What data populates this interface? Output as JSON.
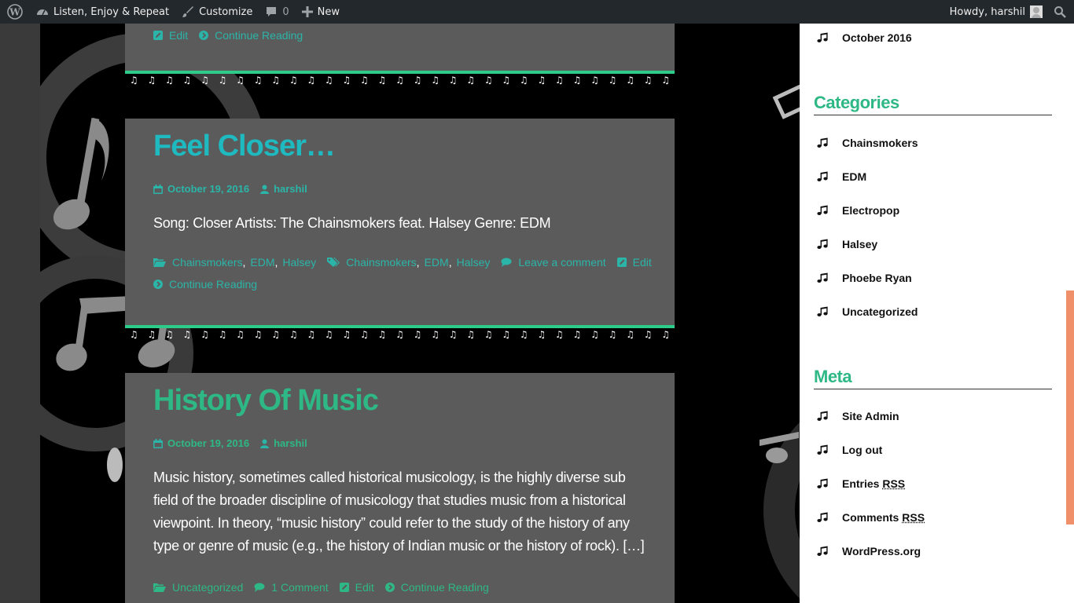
{
  "adminbar": {
    "site_name": "Listen, Enjoy & Repeat",
    "customize": "Customize",
    "comments_count": "0",
    "new_label": "New",
    "howdy": "Howdy, harshil"
  },
  "posts": [
    {
      "footer": {
        "edit": "Edit",
        "continue": "Continue Reading"
      }
    },
    {
      "title": "Feel Closer…",
      "date": "October 19, 2016",
      "author": "harshil",
      "excerpt": "Song: Closer Artists: The Chainsmokers feat. Halsey Genre: EDM",
      "categories": [
        "Chainsmokers",
        "EDM",
        "Halsey"
      ],
      "tags": [
        "Chainsmokers",
        "EDM",
        "Halsey"
      ],
      "comments": "Leave a comment",
      "edit": "Edit",
      "continue": "Continue Reading"
    },
    {
      "title": "History Of Music",
      "date": "October 19, 2016",
      "author": "harshil",
      "excerpt": "Music history, sometimes called historical musicology, is the highly diverse sub field of the broader discipline of musicology that studies music from a historical viewpoint. In theory, “music history” could refer to the study of the history of any type or genre of music (e.g., the history of Indian music or the history of rock). […]",
      "category": "Uncategorized",
      "comments": "1 Comment",
      "edit": "Edit",
      "continue": "Continue Reading"
    }
  ],
  "sidebar": {
    "archives": [
      "October 2016"
    ],
    "categories_title": "Categories",
    "categories": [
      "Chainsmokers",
      "EDM",
      "Electropop",
      "Halsey",
      "Phoebe Ryan",
      "Uncategorized"
    ],
    "meta_title": "Meta",
    "meta": {
      "site_admin": "Site Admin",
      "log_out": "Log out",
      "entries": "Entries",
      "comments": "Comments",
      "rss": "RSS",
      "wordpress": "WordPress.org"
    }
  },
  "colors": {
    "accent_teal": "#2bb5a8",
    "accent_green": "#2eb886",
    "post_bg": "#5b5b5b",
    "scroll_thumb": "#f0906a"
  }
}
